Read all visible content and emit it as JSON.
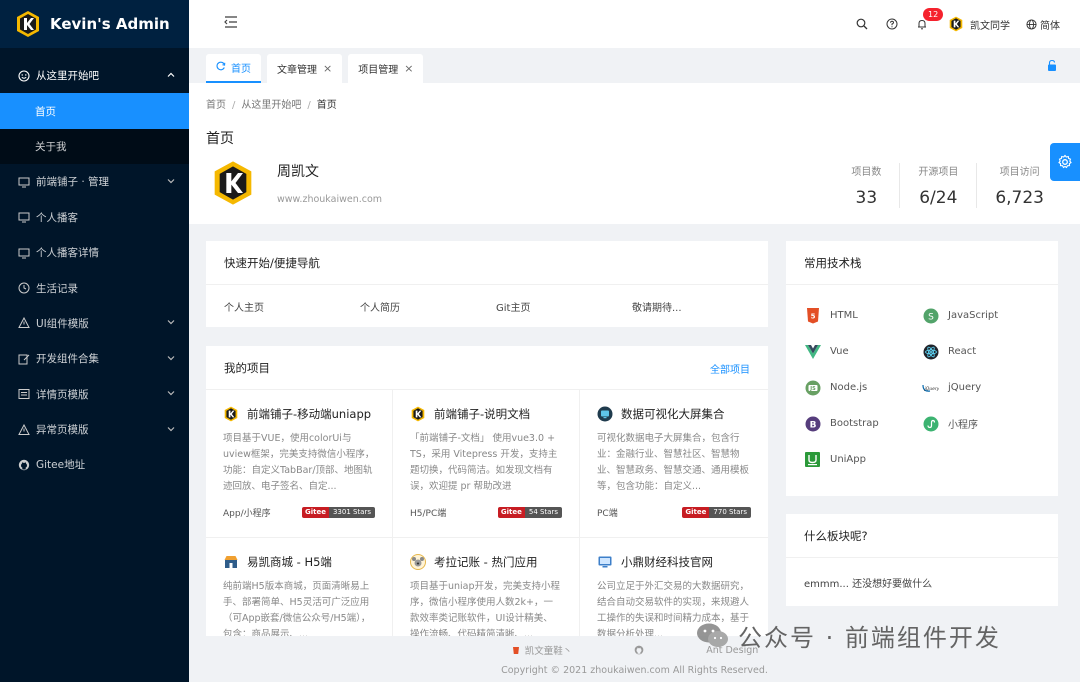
{
  "app": {
    "title": "Kevin's Admin"
  },
  "sidebar": {
    "items": [
      {
        "label": "从这里开始吧",
        "icon": "smile-icon"
      },
      {
        "label": "首页"
      },
      {
        "label": "关于我"
      },
      {
        "label": "前端铺子 · 管理",
        "icon": "desktop-icon"
      },
      {
        "label": "个人播客",
        "icon": "desktop-icon"
      },
      {
        "label": "个人播客详情",
        "icon": "desktop-icon"
      },
      {
        "label": "生活记录",
        "icon": "clock-icon"
      },
      {
        "label": "UI组件模版",
        "icon": "warning-icon"
      },
      {
        "label": "开发组件合集",
        "icon": "edit-icon"
      },
      {
        "label": "详情页模版",
        "icon": "profile-icon"
      },
      {
        "label": "异常页模版",
        "icon": "warning-icon"
      },
      {
        "label": "Gitee地址",
        "icon": "github-icon"
      }
    ]
  },
  "header": {
    "notifications": "12",
    "username": "凯文同学",
    "language": "简体"
  },
  "tabs": [
    {
      "label": "首页"
    },
    {
      "label": "文章管理"
    },
    {
      "label": "项目管理"
    }
  ],
  "breadcrumb": [
    "首页",
    "从这里开始吧",
    "首页"
  ],
  "page": {
    "title": "首页",
    "name": "周凯文",
    "site": "www.zhoukaiwen.com"
  },
  "stats": [
    {
      "label": "项目数",
      "value": "33"
    },
    {
      "label": "开源项目",
      "value": "6/24"
    },
    {
      "label": "项目访问",
      "value": "6,723"
    }
  ],
  "quick": {
    "title": "快速开始/便捷导航",
    "links": [
      "个人主页",
      "个人简历",
      "Git主页",
      "敬请期待..."
    ]
  },
  "projects": {
    "title": "我的项目",
    "more": "全部项目",
    "items": [
      {
        "name": "前端铺子-移动端uniapp",
        "desc": "项目基于VUE，使用colorUi与uview框架，完美支持微信小程序，功能：自定义TabBar/顶部、地图轨迹回放、电子签名、自定...",
        "tag": "App/小程序",
        "stars": "3301 Stars"
      },
      {
        "name": "前端铺子-说明文档",
        "desc": "「前端铺子-文档」 使用vue3.0 + TS，采用 Vitepress 开发，支持主题切换，代码简洁。如发现文档有误，欢迎提 pr 帮助改进",
        "tag": "H5/PC端",
        "stars": "54 Stars"
      },
      {
        "name": "数据可视化大屏集合",
        "desc": "可视化数据电子大屏集合，包含行业：金融行业、智慧社区、智慧物业、智慧政务、智慧交通、通用模板等，包含功能：自定义...",
        "tag": "PC端",
        "stars": "770 Stars"
      },
      {
        "name": "易凯商城 - H5端",
        "desc": "纯前端H5版本商城，页面清晰易上手、部署简单、H5灵活可广泛应用（可App嵌套/微信公众号/H5端），包含：商品展示、..."
      },
      {
        "name": "考拉记账 - 热门应用",
        "desc": "项目基于uniap开发，完美支持小程序，微信小程序使用人数2k+，一款效率类记账软件，UI设计精美、操作流畅、代码精简清晰、..."
      },
      {
        "name": "小鼎财经科技官网",
        "desc": "公司立足于外汇交易的大数据研究，结合自动交易软件的实现，来规避人工操作的失误和时间精力成本，基于数据分析处理..."
      }
    ],
    "badge_label": "Gitee"
  },
  "tech": {
    "title": "常用技术栈",
    "items": [
      {
        "name": "HTML",
        "color": "#e34f26"
      },
      {
        "name": "JavaScript",
        "color": "#52a36a"
      },
      {
        "name": "Vue",
        "color": "#42b883"
      },
      {
        "name": "React",
        "color": "#20232a"
      },
      {
        "name": "Node.js",
        "color": "#68a063"
      },
      {
        "name": "jQuery",
        "color": "#0769ad"
      },
      {
        "name": "Bootstrap",
        "color": "#563d7c"
      },
      {
        "name": "小程序",
        "color": "#3cb371"
      },
      {
        "name": "UniApp",
        "color": "#2b9939"
      }
    ]
  },
  "board": {
    "title": "什么板块呢?",
    "text": "emmm... 还没想好要做什么"
  },
  "footer": {
    "links": [
      "凯文童鞋丶",
      "",
      "Ant Design"
    ],
    "copyright": "Copyright © 2021 zhoukaiwen.com All Rights Reserved."
  },
  "watermark": "公众号 · 前端组件开发",
  "colors": {
    "sidebar": "#001529",
    "accent": "#1890ff",
    "gitee": "#c71d23"
  }
}
